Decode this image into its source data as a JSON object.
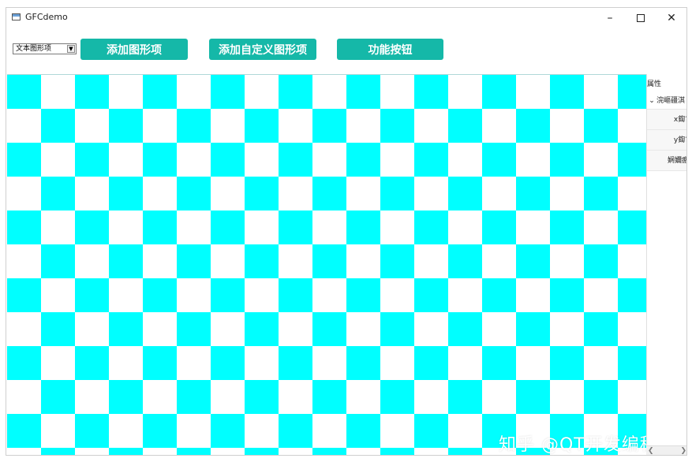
{
  "window": {
    "title": "GFCdemo"
  },
  "toolbar": {
    "select_value": "文本图形项",
    "buttons": [
      "添加图形项",
      "添加自定义图形项",
      "功能按钮"
    ]
  },
  "canvas": {
    "pattern": "checkerboard",
    "colors": {
      "cyan": "#00ffff",
      "white": "#ffffff",
      "accent": "#15b8a8"
    }
  },
  "properties": {
    "header": "属性",
    "group": "浣嶇疆淇",
    "rows": [
      "x鍧?",
      "y鍧?",
      "娴嬭瘯"
    ]
  },
  "watermark": "知乎 @QT开发编程"
}
